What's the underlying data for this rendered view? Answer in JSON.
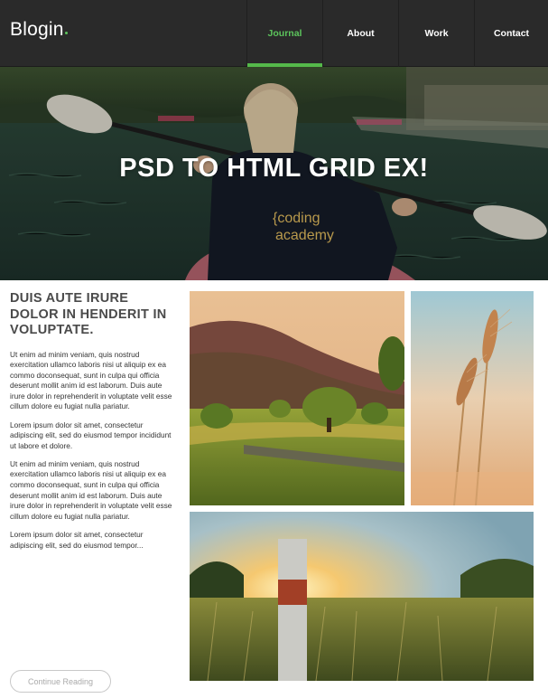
{
  "nav": {
    "logo": "Blogin",
    "items": [
      {
        "label": "Journal",
        "active": true
      },
      {
        "label": "About",
        "active": false
      },
      {
        "label": "Work",
        "active": false
      },
      {
        "label": "Contact",
        "active": false
      }
    ]
  },
  "hero": {
    "title": "PSD TO HTML GRID EX!",
    "shirt_text_line1": "{coding",
    "shirt_text_line2": "academy"
  },
  "article": {
    "title": "DUIS AUTE IRURE DOLOR IN HENDERIT IN VOLUPTATE.",
    "paragraphs": [
      "Ut enim ad minim veniam, quis nostrud exercitation ullamco laboris nisi ut aliquip ex ea commo doconsequat, sunt in culpa qui officia deserunt mollit anim id est laborum. Duis aute irure dolor in reprehenderit in voluptate velit esse cillum dolore eu fugiat nulla pariatur.",
      "Lorem ipsum dolor sit amet, consectetur adipiscing elit, sed do eiusmod tempor incididunt ut labore et dolore.",
      "Ut enim ad minim veniam, quis nostrud exercitation ullamco laboris nisi ut aliquip ex ea commo doconsequat, sunt in culpa qui officia deserunt mollit anim id est laborum. Duis aute irure dolor in reprehenderit in voluptate velit esse cillum dolore eu fugiat nulla pariatur.",
      "Lorem ipsum dolor sit amet, consectetur adipiscing elit, sed do eiusmod tempor..."
    ],
    "button_label": "Continue Reading"
  },
  "colors": {
    "nav_bg": "#2a2a2a",
    "accent": "#55b94a",
    "text_dark": "#4a4a4a"
  }
}
